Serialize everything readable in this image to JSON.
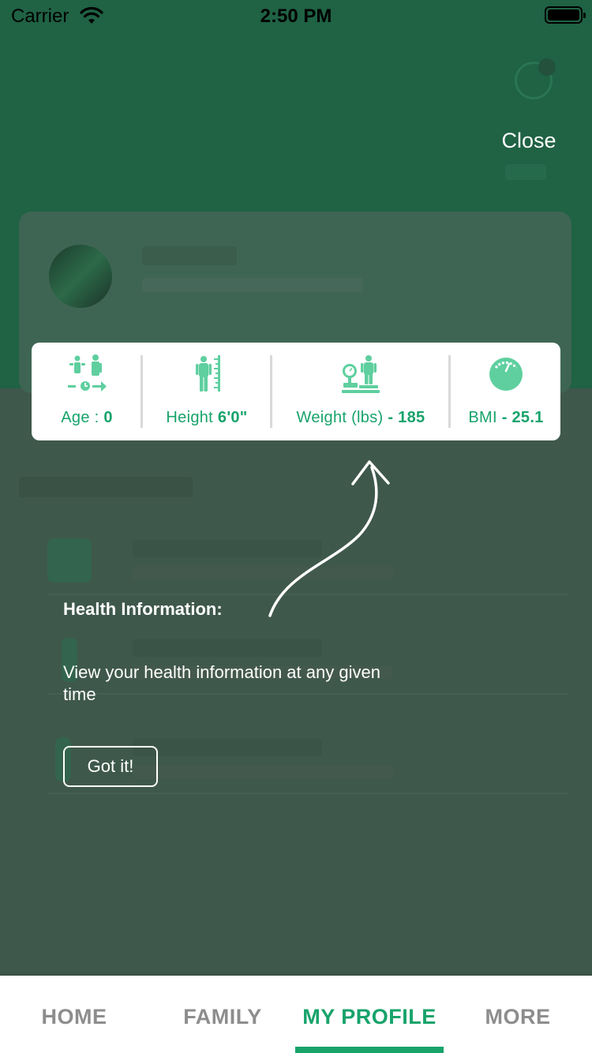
{
  "status_bar": {
    "carrier": "Carrier",
    "time": "2:50 PM"
  },
  "overlay": {
    "close_label": "Close"
  },
  "health_stats": [
    {
      "icon": "age-family-icon",
      "label": "Age : ",
      "value": "0"
    },
    {
      "icon": "height-ruler-icon",
      "label": "Height ",
      "value": "6'0\""
    },
    {
      "icon": "weight-scale-icon",
      "label": "Weight (lbs) ",
      "value": "- 185"
    },
    {
      "icon": "bmi-gauge-icon",
      "label": "BMI ",
      "value": "- 25.1"
    }
  ],
  "tooltip": {
    "title": "Health Information:",
    "body": "View your health information at any given time",
    "button_label": "Got it!"
  },
  "tab_bar": {
    "tabs": [
      {
        "label": "HOME",
        "active": false
      },
      {
        "label": "FAMILY",
        "active": false
      },
      {
        "label": "MY PROFILE",
        "active": true
      },
      {
        "label": "MORE",
        "active": false
      }
    ]
  },
  "colors": {
    "accent": "#18a36b",
    "header_dim": "#1f6244",
    "overlay_bg": "#3f584c"
  }
}
